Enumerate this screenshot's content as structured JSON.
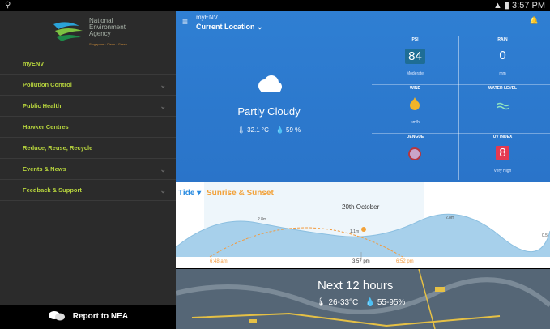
{
  "status_bar": {
    "left_icon": "location-pin-icon",
    "time": "3:57 PM",
    "right_icons": [
      "sim-icon",
      "wifi-icon",
      "battery-icon"
    ]
  },
  "drawer": {
    "logo": {
      "line1": "National",
      "line2": "Environment",
      "line3": "Agency",
      "tagline": "Singapore · Clean · Green"
    },
    "menu": [
      {
        "label": "myENV",
        "expandable": false
      },
      {
        "label": "Pollution Control",
        "expandable": true
      },
      {
        "label": "Public Health",
        "expandable": true
      },
      {
        "label": "Hawker Centres",
        "expandable": false
      },
      {
        "label": "Reduce, Reuse, Recycle",
        "expandable": false
      },
      {
        "label": "Events & News",
        "expandable": true
      },
      {
        "label": "Feedback & Support",
        "expandable": true
      }
    ],
    "report_label": "Report to NEA",
    "chevron": "⌄"
  },
  "app": {
    "title": "myENV",
    "location": "Current Location",
    "location_caret": "⌄"
  },
  "weather": {
    "condition": "Partly Cloudy",
    "temperature": "32.1 °C",
    "humidity": "59 %",
    "temp_icon": "thermometer-icon",
    "humidity_icon": "droplet-icon",
    "colors": {
      "hero_bg": "#2f7fd3",
      "accent_green": "#b7d43d"
    }
  },
  "metrics": {
    "psi": {
      "title": "PSI",
      "value": "84",
      "sub": "Moderate"
    },
    "rain": {
      "title": "RAIN",
      "value": "0",
      "sub": "mm"
    },
    "wind": {
      "title": "WIND",
      "sub": "km/h"
    },
    "water": {
      "title": "WATER LEVEL"
    },
    "dengue": {
      "title": "DENGUE"
    },
    "uv": {
      "title": "UV INDEX",
      "value": "8",
      "sub": "Very High",
      "color": "#e53950"
    }
  },
  "tide": {
    "tab_tide": "Tide",
    "tab_sun": "Sunrise & Sunset",
    "date": "20th October",
    "times": {
      "sunrise": "6:48 am",
      "now": "3:57 pm",
      "sunset": "6:52 pm"
    },
    "tide_labels": [
      "2.8m",
      "1.1m",
      "2.8m",
      "0.5"
    ]
  },
  "forecast": {
    "title": "Next 12 hours",
    "temp_range": "26-33°C",
    "humidity_range": "55-95%"
  }
}
